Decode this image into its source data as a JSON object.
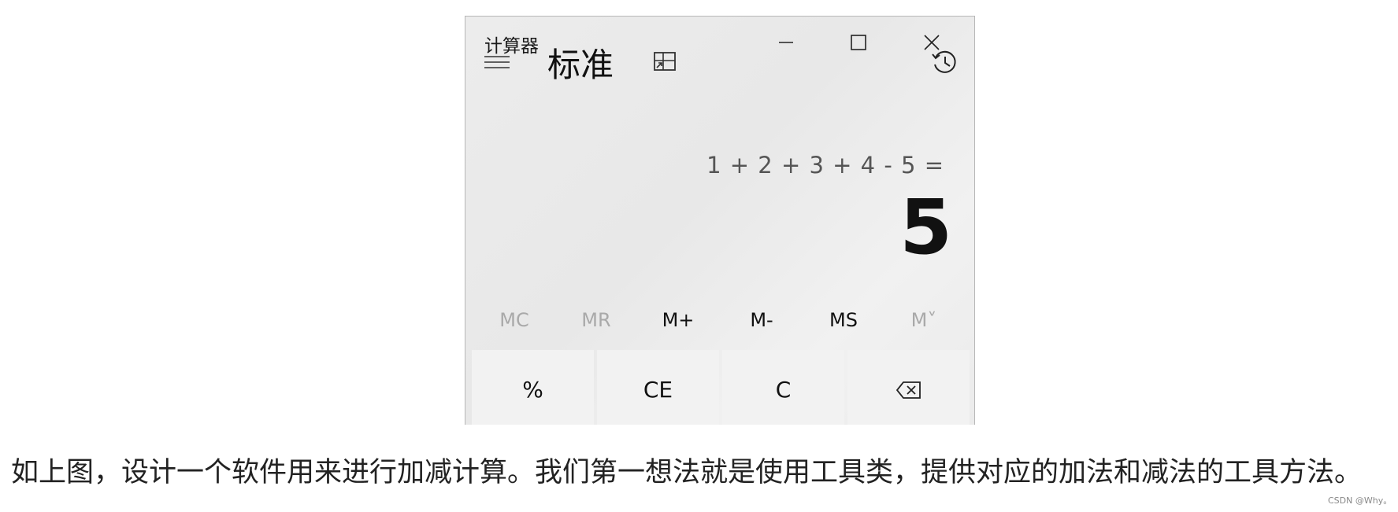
{
  "window": {
    "title": "计算器",
    "controls": [
      "minimize-icon",
      "maximize-icon",
      "close-icon"
    ]
  },
  "header": {
    "mode": "标准",
    "icons": [
      "menu-icon",
      "keep-on-top-icon",
      "history-icon"
    ]
  },
  "display": {
    "expression": "1 + 2 + 3 + 4 - 5 =",
    "result": "5"
  },
  "memory": {
    "buttons": [
      {
        "label": "MC",
        "enabled": false
      },
      {
        "label": "MR",
        "enabled": false
      },
      {
        "label": "M+",
        "enabled": true
      },
      {
        "label": "M-",
        "enabled": true
      },
      {
        "label": "MS",
        "enabled": true
      },
      {
        "label": "M˅",
        "enabled": false
      }
    ]
  },
  "keys": {
    "row1": [
      "%",
      "CE",
      "C",
      "backspace-icon"
    ]
  },
  "caption": "如上图，设计一个软件用来进行加减计算。我们第一想法就是使用工具类，提供对应的加法和减法的工具方法。",
  "watermark": "CSDN @Why。",
  "colors": {
    "background": "#e9e9e9",
    "key": "#f2f2f2",
    "disabled": "#a9a9a9",
    "text": "#111111"
  }
}
